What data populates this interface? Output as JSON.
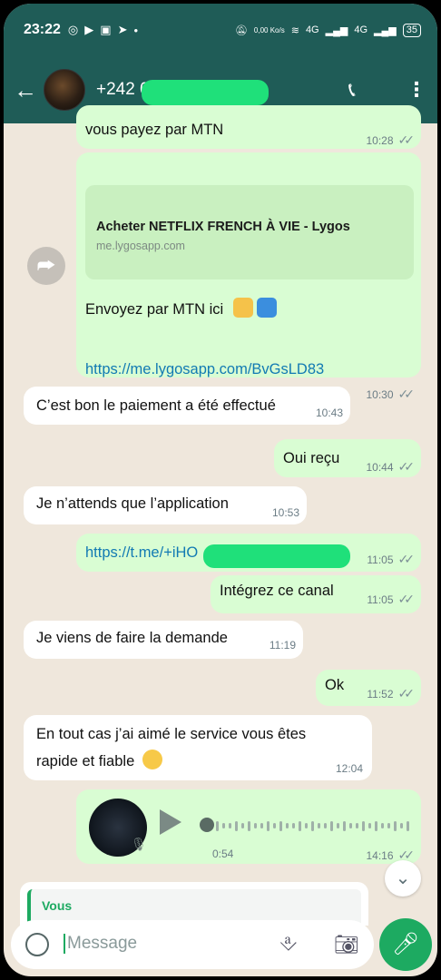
{
  "status_bar": {
    "time": "23:22",
    "net_speed": "0,00 Ko/s",
    "network": "4G",
    "battery": "35"
  },
  "header": {
    "contact": "+242 0"
  },
  "messages": [
    {
      "text": "vous payez par MTN",
      "time": "10:28"
    },
    {
      "preview_title": "Acheter NETFLIX FRENCH À VIE - Lygos",
      "preview_domain": "me.lygosapp.com",
      "text": "Envoyez par MTN ici",
      "link": "https://me.lygosapp.com/BvGsLD83",
      "time": "10:30"
    },
    {
      "text": "C’est bon le paiement a été effectué",
      "time": "10:43"
    },
    {
      "text": "Oui reçu",
      "time": "10:44"
    },
    {
      "text": "Je n’attends que l’application",
      "time": "10:53"
    },
    {
      "link": "https://t.me/+iHO",
      "time": "11:05"
    },
    {
      "text": "Intégrez ce canal",
      "time": "11:05"
    },
    {
      "text": "Je viens de faire la demande",
      "time": "11:19"
    },
    {
      "text": "Ok",
      "time": "11:52"
    },
    {
      "text_line1": "En tout cas j’ai aimé le service vous êtes",
      "text_line2": "rapide et fiable",
      "time": "12:04"
    },
    {
      "duration": "0:54",
      "time": "14:16"
    }
  ],
  "reply": {
    "label": "Vous"
  },
  "composer": {
    "placeholder": "Message"
  },
  "colors": {
    "header": "#1f5c57",
    "outgoing": "#d9fdd3",
    "incoming": "#ffffff",
    "accent": "#1daa61"
  }
}
